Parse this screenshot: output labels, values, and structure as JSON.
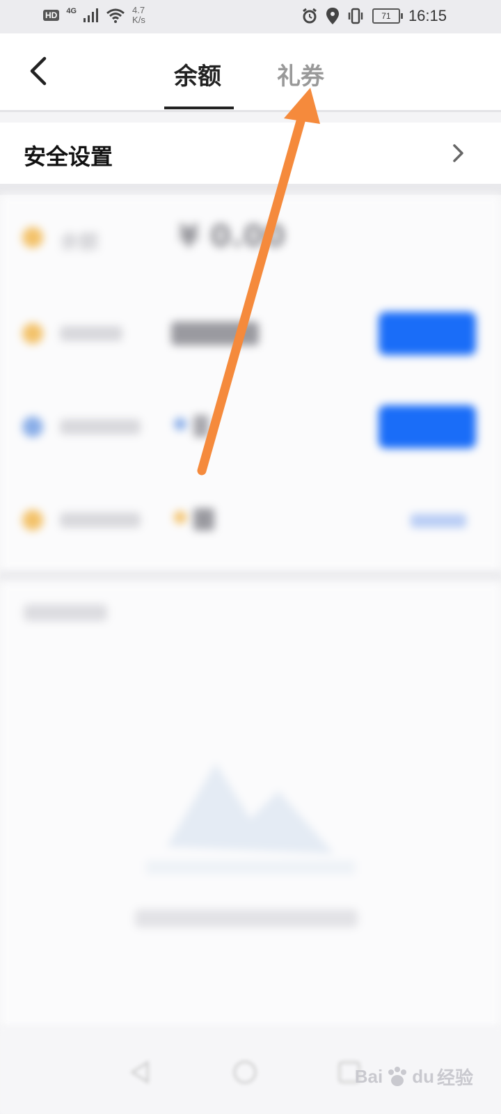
{
  "status_bar": {
    "hd": "HD",
    "network": "4G",
    "speed_value": "4.7",
    "speed_unit": "K/s",
    "battery": "71",
    "time": "16:15"
  },
  "header": {
    "tabs": [
      {
        "label": "余额",
        "active": true
      },
      {
        "label": "礼券",
        "active": false
      }
    ]
  },
  "security": {
    "label": "安全设置"
  },
  "blurred": {
    "balance_label": "余额",
    "balance_value": "¥ 0.00"
  },
  "watermark": {
    "text": "Bai",
    "text2": "du",
    "text3": "经验"
  },
  "colors": {
    "accent": "#1a6df8",
    "annotation_arrow": "#f58a3c",
    "coin": "#f3c26a"
  }
}
